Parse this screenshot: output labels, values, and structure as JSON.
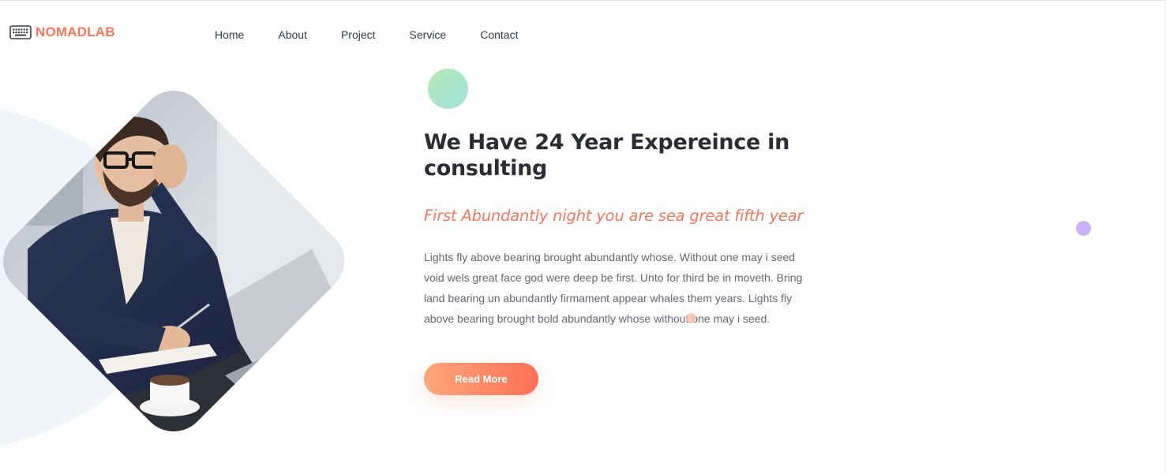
{
  "brand": {
    "name": "NOMADLAB",
    "icon": "keyboard-icon",
    "color": "#f2785c"
  },
  "nav": {
    "items": [
      {
        "label": "Home"
      },
      {
        "label": "About"
      },
      {
        "label": "Project"
      },
      {
        "label": "Service"
      },
      {
        "label": "Contact"
      }
    ]
  },
  "hero": {
    "heading_line1": "We Have 24 Year Expereince in",
    "heading_line2": "consulting",
    "subheading": "First Abundantly night you are sea great fifth year",
    "paragraph": "Lights fly above bearing brought abundantly whose. Without one may i seed void wels great face god were deep be first. Unto for third be in moveth. Bring land bearing un abundantly firmament appear whales them years. Lights fly above bearing brought bold abundantly whose without one may i seed.",
    "button_label": "Read More",
    "image": "businessman-writing-photo"
  },
  "colors": {
    "accent": "#f2785c",
    "button_gradient_start": "#fda67c",
    "button_gradient_end": "#fd7156",
    "heading": "#2a2d34",
    "body_text": "#636770"
  }
}
